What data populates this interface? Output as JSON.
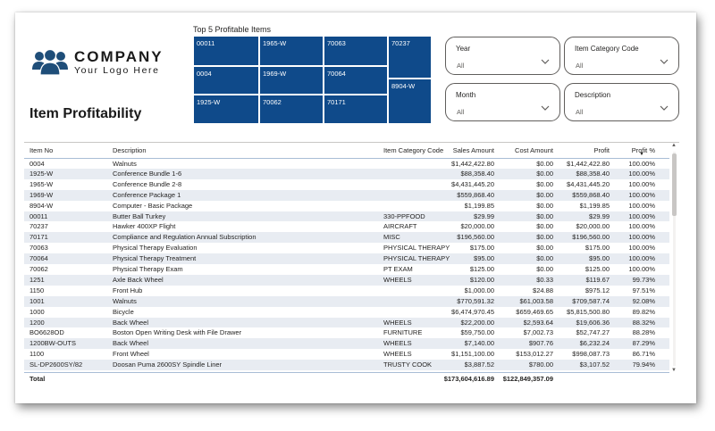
{
  "logo": {
    "name": "COMPANY",
    "tagline": "Your Logo Here",
    "color": "#1f4e79"
  },
  "page_title": "Item Profitability",
  "treemap": {
    "title": "Top 5 Profitable Items",
    "color": "#0f4a8a",
    "cells": [
      {
        "label": "00011"
      },
      {
        "label": "1965-W"
      },
      {
        "label": "70063"
      },
      {
        "label": "70237"
      },
      {
        "label": "0004"
      },
      {
        "label": "1969-W"
      },
      {
        "label": "70064"
      },
      {
        "label": "8904-W"
      },
      {
        "label": "1925-W"
      },
      {
        "label": "70062"
      },
      {
        "label": "70171"
      }
    ]
  },
  "slicers": [
    {
      "title": "Year",
      "value": "All"
    },
    {
      "title": "Item Category Code",
      "value": "All"
    },
    {
      "title": "Month",
      "value": "All"
    },
    {
      "title": "Description",
      "value": "All"
    }
  ],
  "table": {
    "columns": [
      "Item No",
      "Description",
      "Item Category Code",
      "Sales Amount",
      "Cost Amount",
      "Profit",
      "Profit %"
    ],
    "sort_column": "Profit %",
    "rows": [
      [
        "0004",
        "Walnuts",
        "",
        "$1,442,422.80",
        "$0.00",
        "$1,442,422.80",
        "100.00%"
      ],
      [
        "1925-W",
        "Conference Bundle 1-6",
        "",
        "$88,358.40",
        "$0.00",
        "$88,358.40",
        "100.00%"
      ],
      [
        "1965-W",
        "Conference Bundle 2-8",
        "",
        "$4,431,445.20",
        "$0.00",
        "$4,431,445.20",
        "100.00%"
      ],
      [
        "1969-W",
        "Conference Package 1",
        "",
        "$559,868.40",
        "$0.00",
        "$559,868.40",
        "100.00%"
      ],
      [
        "8904-W",
        "Computer - Basic Package",
        "",
        "$1,199.85",
        "$0.00",
        "$1,199.85",
        "100.00%"
      ],
      [
        "00011",
        "Butter Ball Turkey",
        "330-PPFOOD",
        "$29.99",
        "$0.00",
        "$29.99",
        "100.00%"
      ],
      [
        "70237",
        "Hawker 400XP Flight",
        "AIRCRAFT",
        "$20,000.00",
        "$0.00",
        "$20,000.00",
        "100.00%"
      ],
      [
        "70171",
        "Compliance and Regulation Annual Subscription",
        "MISC",
        "$196,560.00",
        "$0.00",
        "$196,560.00",
        "100.00%"
      ],
      [
        "70063",
        "Physical Therapy Evaluation",
        "PHYSICAL THERAPY",
        "$175.00",
        "$0.00",
        "$175.00",
        "100.00%"
      ],
      [
        "70064",
        "Physical Therapy Treatment",
        "PHYSICAL THERAPY",
        "$95.00",
        "$0.00",
        "$95.00",
        "100.00%"
      ],
      [
        "70062",
        "Physical Therapy Exam",
        "PT EXAM",
        "$125.00",
        "$0.00",
        "$125.00",
        "100.00%"
      ],
      [
        "1251",
        "Axle Back Wheel",
        "WHEELS",
        "$120.00",
        "$0.33",
        "$119.67",
        "99.73%"
      ],
      [
        "1150",
        "Front Hub",
        "",
        "$1,000.00",
        "$24.88",
        "$975.12",
        "97.51%"
      ],
      [
        "1001",
        "Walnuts",
        "",
        "$770,591.32",
        "$61,003.58",
        "$709,587.74",
        "92.08%"
      ],
      [
        "1000",
        "Bicycle",
        "",
        "$6,474,970.45",
        "$659,469.65",
        "$5,815,500.80",
        "89.82%"
      ],
      [
        "1200",
        "Back Wheel",
        "WHEELS",
        "$22,200.00",
        "$2,593.64",
        "$19,606.36",
        "88.32%"
      ],
      [
        "BO6628OD",
        "Boston Open Writing Desk with File Drawer",
        "FURNITURE",
        "$59,750.00",
        "$7,002.73",
        "$52,747.27",
        "88.28%"
      ],
      [
        "1200BW-OUTS",
        "Back Wheel",
        "WHEELS",
        "$7,140.00",
        "$907.76",
        "$6,232.24",
        "87.29%"
      ],
      [
        "1100",
        "Front Wheel",
        "WHEELS",
        "$1,151,100.00",
        "$153,012.27",
        "$998,087.73",
        "86.71%"
      ],
      [
        "SL-DP2600SY/82",
        "Doosan Puma 2600SY Spindle Liner",
        "TRUSTY COOK",
        "$3,887.52",
        "$780.00",
        "$3,107.52",
        "79.94%"
      ]
    ],
    "total": {
      "label": "Total",
      "sales": "$173,604,616.89",
      "cost": "$122,849,357.09",
      "profit": "",
      "pct": ""
    }
  }
}
